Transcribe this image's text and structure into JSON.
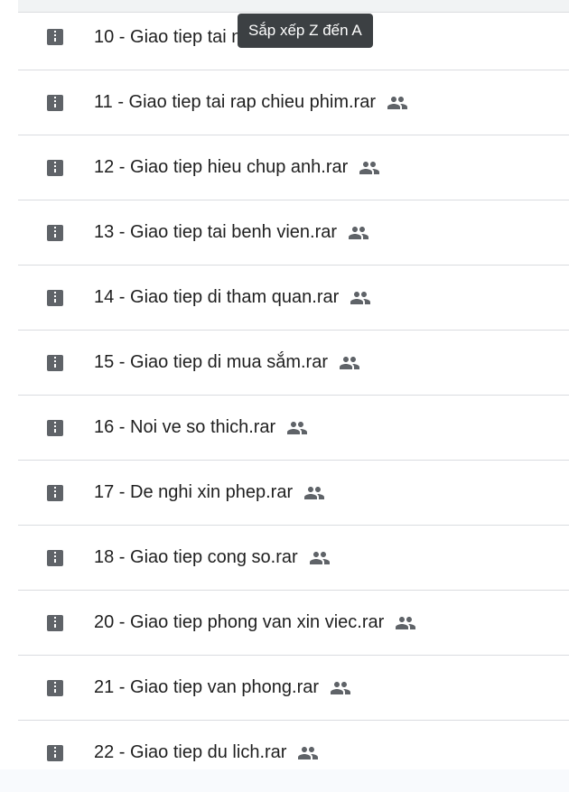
{
  "tooltip": {
    "text": "Sắp xếp Z đến A"
  },
  "colors": {
    "icon": "#5f6368",
    "text": "#1f1f1f",
    "divider": "#dadce0",
    "tooltip_bg": "#3c4043"
  },
  "files": [
    {
      "name": "10 - Giao tiep tai nha hang.rar",
      "icon": "archive-icon",
      "shared": true
    },
    {
      "name": "11 - Giao tiep tai rap chieu phim.rar",
      "icon": "archive-icon",
      "shared": true
    },
    {
      "name": "12 - Giao tiep hieu chup anh.rar",
      "icon": "archive-icon",
      "shared": true
    },
    {
      "name": "13 - Giao tiep tai benh vien.rar",
      "icon": "archive-icon",
      "shared": true
    },
    {
      "name": "14 - Giao tiep di tham quan.rar",
      "icon": "archive-icon",
      "shared": true
    },
    {
      "name": "15 - Giao tiep di mua sắm.rar",
      "icon": "archive-icon",
      "shared": true
    },
    {
      "name": "16 - Noi ve so thich.rar",
      "icon": "archive-icon",
      "shared": true
    },
    {
      "name": "17 - De nghi xin phep.rar",
      "icon": "archive-icon",
      "shared": true
    },
    {
      "name": "18 - Giao tiep cong so.rar",
      "icon": "archive-icon",
      "shared": true
    },
    {
      "name": "20 - Giao tiep phong van xin viec.rar",
      "icon": "archive-icon",
      "shared": true
    },
    {
      "name": "21 - Giao tiep van phong.rar",
      "icon": "archive-icon",
      "shared": true
    },
    {
      "name": "22 - Giao tiep du lich.rar",
      "icon": "archive-icon",
      "shared": true
    }
  ]
}
